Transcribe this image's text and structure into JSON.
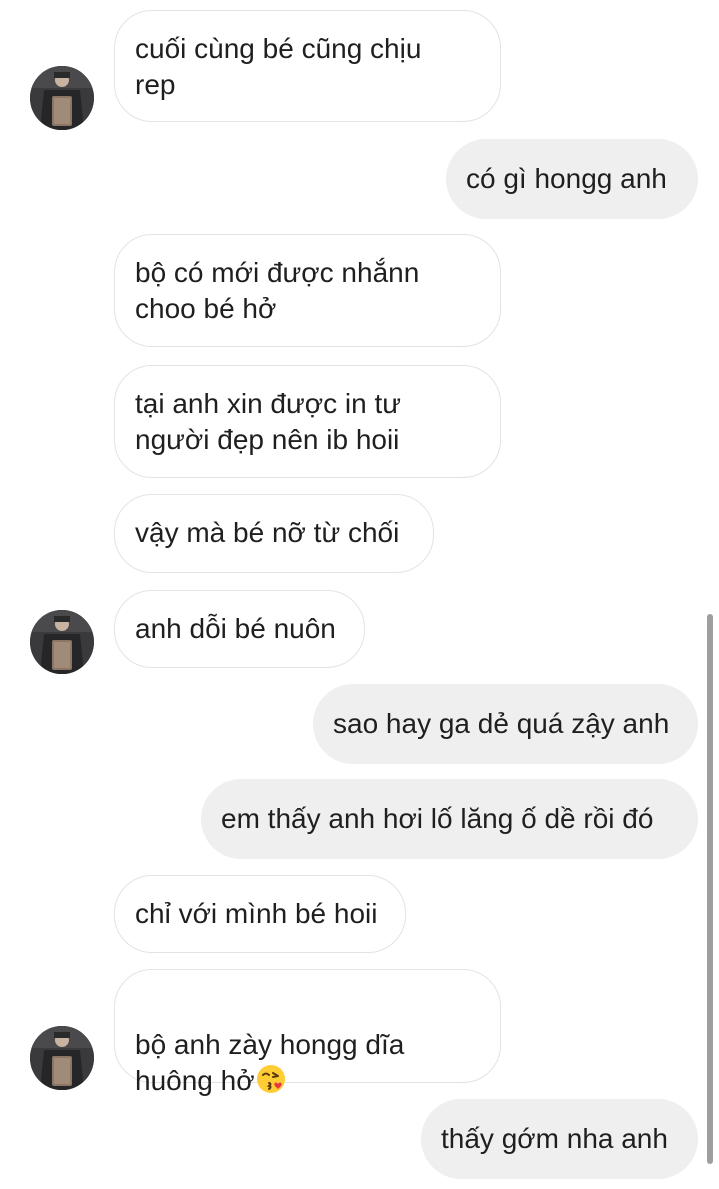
{
  "messages": [
    {
      "side": "in",
      "text": "cuối cùng bé cũng chịu\nrep"
    },
    {
      "side": "out",
      "text": "có gì hongg anh"
    },
    {
      "side": "in",
      "text": "bộ có mới được nhắnn\nchoo bé hở"
    },
    {
      "side": "in",
      "text": "tại anh xin được in tư\nngười đẹp nên ib hoii"
    },
    {
      "side": "in",
      "text": "vậy mà bé nỡ từ chối"
    },
    {
      "side": "in",
      "text": "anh dỗi bé nuôn"
    },
    {
      "side": "out",
      "text": "sao hay ga dẻ quá zậy anh"
    },
    {
      "side": "out",
      "text": "em thấy anh hơi lố lăng ố dề rồi đó"
    },
    {
      "side": "in",
      "text": "chỉ với mình bé hoii"
    },
    {
      "side": "in",
      "text": "bộ anh zày hongg dĩa\nhuông hở",
      "emoji": "kissing-face-emoji"
    },
    {
      "side": "out",
      "text": "thấy gớm nha anh"
    }
  ],
  "colors": {
    "incoming_bubble_bg": "#ffffff",
    "incoming_bubble_border": "#e3e3e3",
    "outgoing_bubble_bg": "#efefef",
    "text": "#1f1f1f",
    "scrollbar": "#9e9e9e"
  },
  "icons": {
    "avatar": "contact-avatar-photo",
    "emoji": "kissing-face-emoji"
  }
}
